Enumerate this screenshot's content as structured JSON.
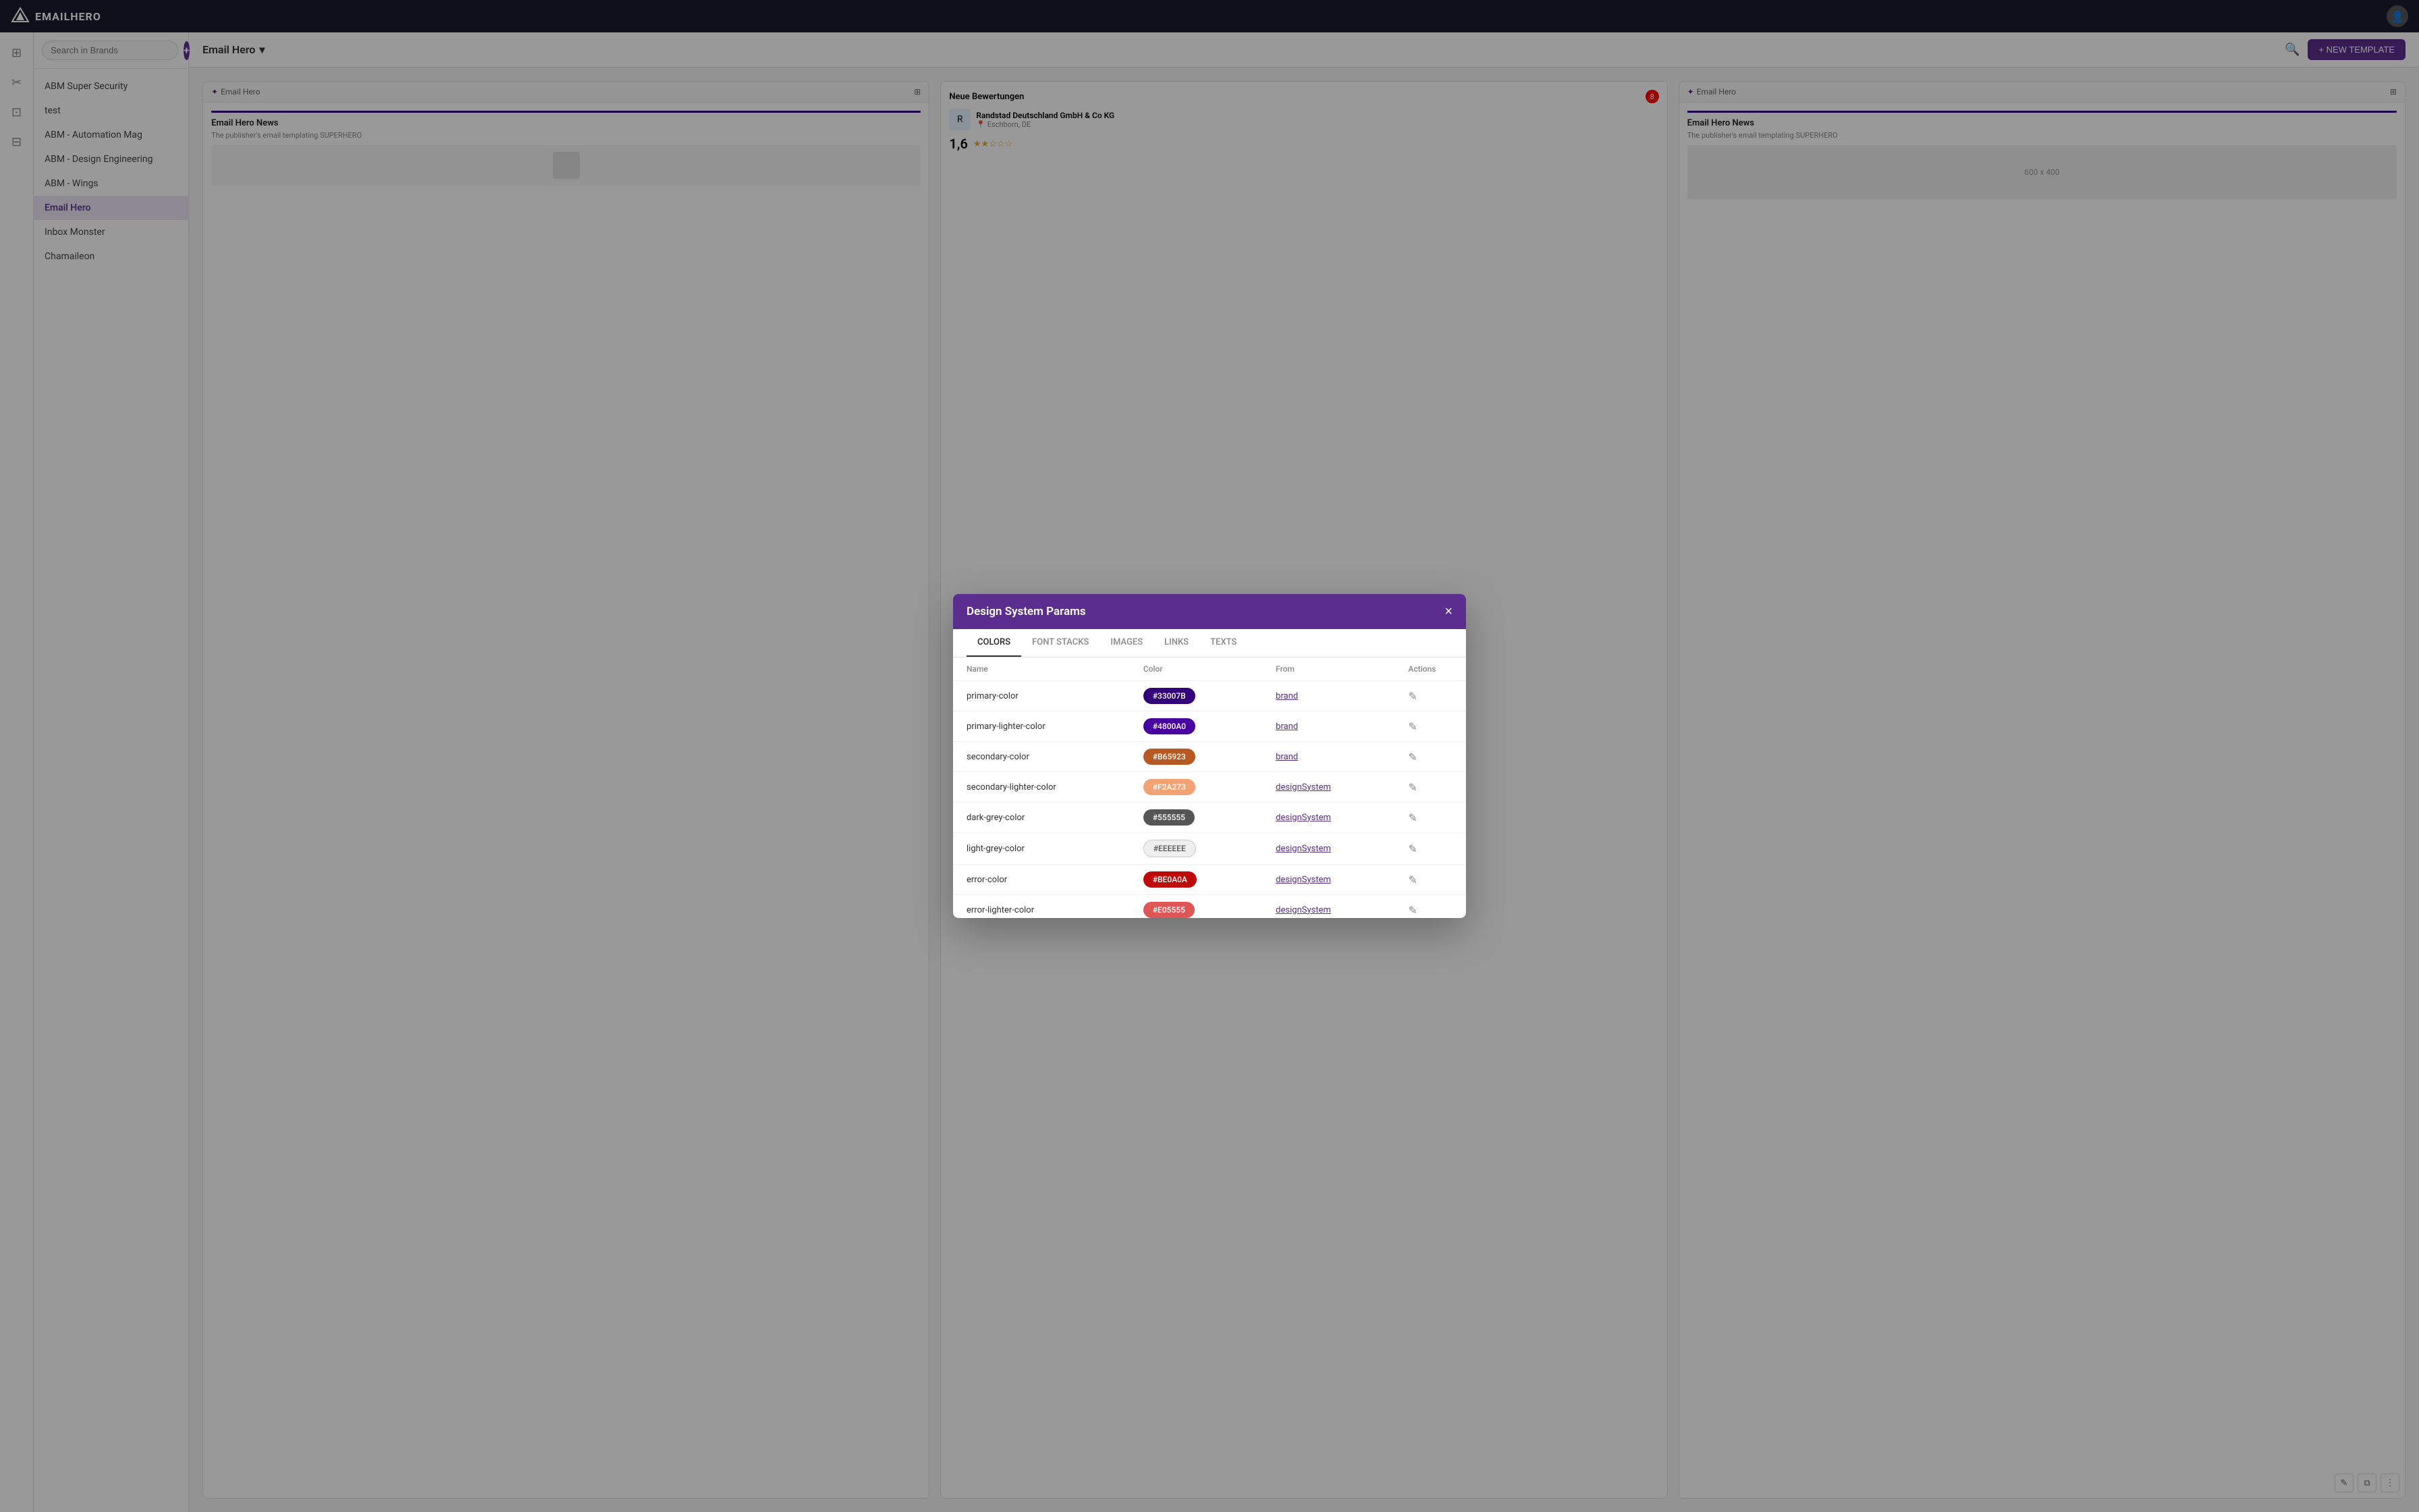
{
  "app": {
    "name": "EMAILHERO",
    "logo_symbol": "✦"
  },
  "topnav": {
    "avatar_icon": "👤"
  },
  "sidebar_icons": [
    {
      "name": "dashboard-icon",
      "symbol": "⊞"
    },
    {
      "name": "tools-icon",
      "symbol": "✂"
    },
    {
      "name": "grid-icon",
      "symbol": "⊡"
    },
    {
      "name": "apps-icon",
      "symbol": "⊞"
    }
  ],
  "brand_sidebar": {
    "search_placeholder": "Search in Brands",
    "add_label": "+",
    "brands": [
      {
        "id": "abm-super-security",
        "label": "ABM Super Security",
        "active": false
      },
      {
        "id": "test",
        "label": "test",
        "active": false
      },
      {
        "id": "abm-automation-mag",
        "label": "ABM - Automation Mag",
        "active": false
      },
      {
        "id": "abm-design-engineering",
        "label": "ABM - Design Engineering",
        "active": false
      },
      {
        "id": "abm-wings",
        "label": "ABM - Wings",
        "active": false
      },
      {
        "id": "email-hero",
        "label": "Email Hero",
        "active": true
      },
      {
        "id": "inbox-monster",
        "label": "Inbox Monster",
        "active": false
      },
      {
        "id": "chamaileon",
        "label": "Chamaileon",
        "active": false
      }
    ]
  },
  "main": {
    "brand_title": "Email Hero",
    "dropdown_icon": "▾",
    "new_template_label": "+ NEW TEMPLATE",
    "search_icon": "🔍"
  },
  "templates": [
    {
      "id": "card1",
      "brand_tag": "Email Hero",
      "brand_icon": "✦",
      "grid_icon": "⊞",
      "preview_bar_color": "#33007B",
      "preview_title": "Email Hero News",
      "preview_subtitle": "The publisher's email templating SUPERHERO",
      "type": "email_preview"
    },
    {
      "id": "card2",
      "type": "review",
      "header": "Neue Bewertungen",
      "badge_count": "8",
      "company_name": "Randstad Deutschland GmbH & Co KG",
      "company_location": "Eschborn, DE",
      "company_logo": "R",
      "rating": "1,6",
      "stars": "★★☆☆☆"
    },
    {
      "id": "card3",
      "brand_tag": "Email Hero",
      "brand_icon": "✦",
      "grid_icon": "⊞",
      "preview_bar_color": "#33007B",
      "preview_title": "Email Hero News",
      "preview_subtitle": "The publisher's email templating SUPERHERO",
      "placeholder_text": "600 x 400",
      "type": "placeholder_preview"
    }
  ],
  "modal": {
    "title": "Design System Params",
    "close_label": "×",
    "tabs": [
      {
        "id": "colors",
        "label": "COLORS",
        "active": true
      },
      {
        "id": "font-stacks",
        "label": "FONT STACKS",
        "active": false
      },
      {
        "id": "images",
        "label": "IMAGES",
        "active": false
      },
      {
        "id": "links",
        "label": "LINKS",
        "active": false
      },
      {
        "id": "texts",
        "label": "TEXTS",
        "active": false
      }
    ],
    "table_headers": {
      "name": "Name",
      "color": "Color",
      "from": "From",
      "actions": "Actions"
    },
    "colors": [
      {
        "name": "primary-color",
        "hex": "#33007B",
        "chip_bg": "#33007B",
        "text_color": "white",
        "from": "brand"
      },
      {
        "name": "primary-lighter-color",
        "hex": "#4800A0",
        "chip_bg": "#4800A0",
        "text_color": "white",
        "from": "brand"
      },
      {
        "name": "secondary-color",
        "hex": "#B65923",
        "chip_bg": "#B65923",
        "text_color": "white",
        "from": "brand"
      },
      {
        "name": "secondary-lighter-color",
        "hex": "#F2A273",
        "chip_bg": "#F2A273",
        "text_color": "white",
        "from": "designSystem"
      },
      {
        "name": "dark-grey-color",
        "hex": "#555555",
        "chip_bg": "#555555",
        "text_color": "white",
        "from": "designSystem"
      },
      {
        "name": "light-grey-color",
        "hex": "#EEEEEE",
        "chip_bg": "#EEEEEE",
        "text_color": "dark",
        "from": "designSystem"
      },
      {
        "name": "error-color",
        "hex": "#BE0A0A",
        "chip_bg": "#BE0A0A",
        "text_color": "white",
        "from": "designSystem"
      },
      {
        "name": "error-lighter-color",
        "hex": "#E05555",
        "chip_bg": "#E05555",
        "text_color": "white",
        "from": "designSystem"
      }
    ]
  }
}
